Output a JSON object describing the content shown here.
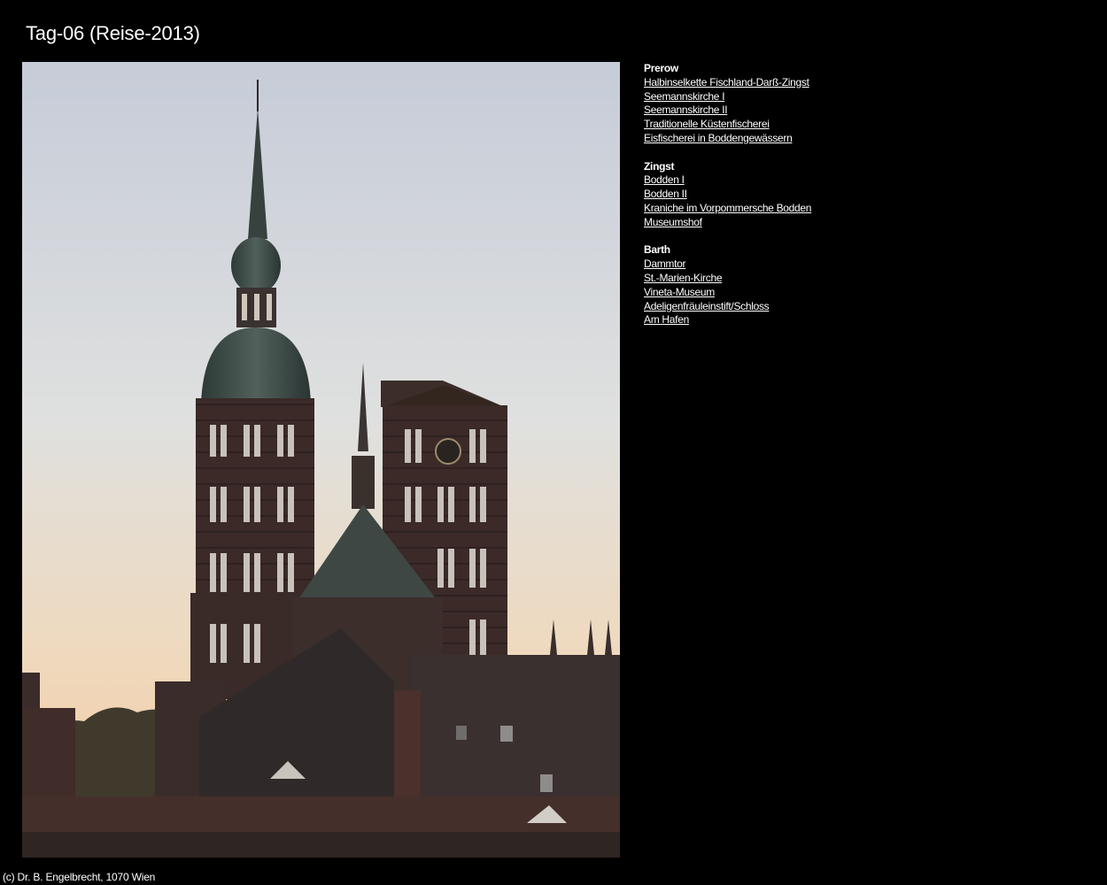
{
  "page": {
    "title": "Tag-06 (Reise-2013)",
    "footer": "(c) Dr. B. Engelbrecht, 1070 Wien"
  },
  "nav": {
    "groups": [
      {
        "heading": "Prerow",
        "links": [
          "Halbinselkette Fischland-Darß-Zingst",
          "Seemannskirche I",
          "Seemannskirche II",
          "Traditionelle Küstenfischerei",
          "Eisfischerei in Boddengewässern"
        ]
      },
      {
        "heading": "Zingst",
        "links": [
          "Bodden I",
          "Bodden II",
          "Kraniche im Vorpommersche Bodden",
          "Museumshof"
        ]
      },
      {
        "heading": "Barth",
        "links": [
          "Dammtor",
          "St.-Marien-Kirche",
          "Vineta-Museum",
          "Adeligenfräuleinstift/Schloss",
          "Am Hafen"
        ]
      }
    ]
  },
  "colors": {
    "background": "#000000",
    "text": "#ffffff",
    "sky_top": "#c9d0da",
    "sky_bottom": "#f2c9a0",
    "silhouette": "#3a2c2a"
  }
}
